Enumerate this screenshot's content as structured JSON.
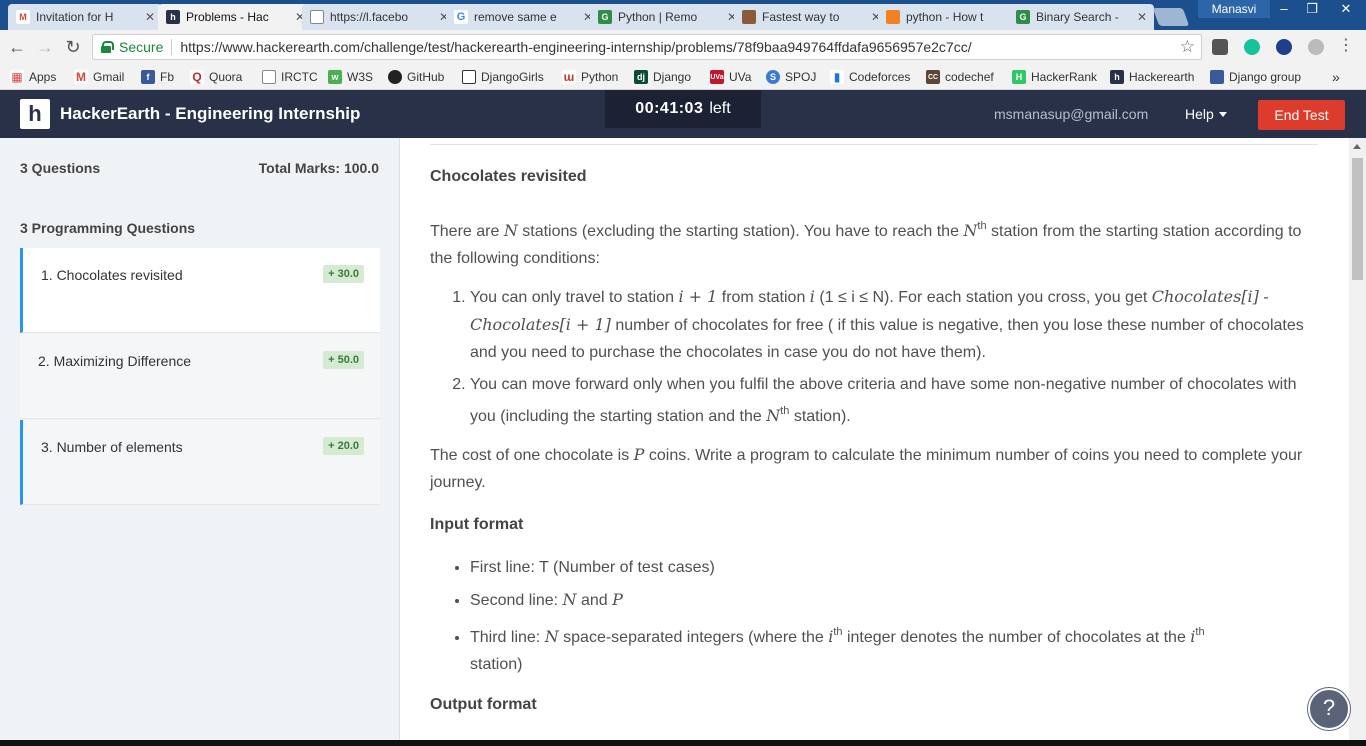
{
  "browser": {
    "tabs": [
      {
        "title": "Invitation for H",
        "icon": "gmail-icon"
      },
      {
        "title": "Problems - Hac",
        "icon": "hackerearth-icon"
      },
      {
        "title": "https://l.facebo",
        "icon": "page-icon"
      },
      {
        "title": "remove same e",
        "icon": "google-icon"
      },
      {
        "title": "Python | Remo",
        "icon": "gfg-icon"
      },
      {
        "title": "Fastest way to",
        "icon": "user-avatar-icon"
      },
      {
        "title": "python - How t",
        "icon": "stackoverflow-icon"
      },
      {
        "title": "Binary Search -",
        "icon": "gfg-icon"
      }
    ],
    "profile_name": "Manasvi",
    "secure_label": "Secure",
    "url": "https://www.hackerearth.com/challenge/test/hackerearth-engineering-internship/problems/78f9baa949764ffdafa9656957e2c7cc/",
    "bookmarks": [
      "Apps",
      "Gmail",
      "Fb",
      "Quora",
      "IRCTC",
      "W3S",
      "GitHub",
      "DjangoGirls",
      "Python",
      "Django",
      "UVa",
      "SPOJ",
      "Codeforces",
      "codechef",
      "HackerRank",
      "Hackerearth",
      "Django group"
    ],
    "more_bookmarks": "»"
  },
  "header": {
    "logo_letter": "h",
    "title": "HackerEarth - Engineering Internship",
    "timer_value": "00:41:03",
    "timer_suffix": "left",
    "email": "msmanasup@gmail.com",
    "help_label": "Help",
    "end_test_label": "End Test"
  },
  "sidebar": {
    "question_count": "3 Questions",
    "total_marks": "Total Marks: 100.0",
    "section_title": "3 Programming Questions",
    "questions": [
      {
        "name": "1. Chocolates revisited",
        "marks": "+ 30.0"
      },
      {
        "name": "2. Maximizing Difference",
        "marks": "+ 50.0"
      },
      {
        "name": "3. Number of elements",
        "marks": "+ 20.0"
      }
    ]
  },
  "problem": {
    "title": "Chocolates revisited",
    "intro_1": "There are ",
    "N": "N",
    "intro_2": " stations (excluding the starting station). You have to reach the ",
    "th": "th",
    "intro_3": " station from the starting station according to the following conditions:",
    "c1_a": "You can only travel to station ",
    "i_plus_1": "i + 1",
    "c1_b": " from station ",
    "i": "i",
    "c1_range": " (1 ≤ i ≤ N)",
    "c1_c": ". For each station you cross, you get ",
    "choc_i": "Chocolates[i]",
    "dash": " - ",
    "choc_i1": "Chocolates[i + 1]",
    "c1_d": " number of chocolates for free ( if this value is negative, then you lose these number of chocolates and you need to purchase the chocolates in case you do not have them).",
    "c2_a": "You can move forward only when you fulfil the above criteria and have some non-negative number of chocolates with you (including the starting station and the ",
    "c2_b": " station).",
    "cost_1": "The cost of one chocolate is ",
    "P": "P",
    "cost_2": " coins. Write a program to calculate the minimum number of coins you need to complete your journey.",
    "input_heading": "Input format",
    "in1": "First line: T (Number of test cases)",
    "in2_a": "Second line: ",
    "and": " and ",
    "in3_a": "Third line: ",
    "in3_b": " space-separated integers (where the ",
    "in3_c": " integer denotes the number of chocolates at the ",
    "in3_d": "station)",
    "output_heading": "Output format"
  },
  "help_fab": "?"
}
